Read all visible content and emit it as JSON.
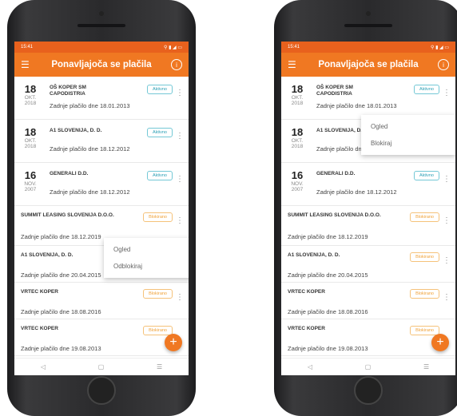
{
  "left": {
    "status_time": "15:41",
    "status_icons": "⚲ ▮ ◢ ▭",
    "appbar": {
      "title": "Ponavljajoča se plačila",
      "menu_icon": "menu-icon",
      "info_icon": "info-icon"
    },
    "rows": [
      {
        "day": "18",
        "month": "OKT.",
        "year": "2018",
        "name": "OŠ KOPER SM CAPODISTRIA",
        "status": "Aktivno",
        "last": "Zadnje plačilo dne 18.01.2013"
      },
      {
        "day": "18",
        "month": "OKT.",
        "year": "2018",
        "name": "A1 SLOVENIJA, D. D.",
        "status": "Aktivno",
        "last": "Zadnje plačilo dne 18.12.2012"
      },
      {
        "day": "16",
        "month": "NOV.",
        "year": "2007",
        "name": "GENERALI D.D.",
        "status": "Aktivno",
        "last": "Zadnje plačilo dne 18.12.2012"
      }
    ],
    "plain_rows": [
      {
        "name": "SUMMIT LEASING SLOVENIJA D.O.O.",
        "status": "Blokirano",
        "last": "Zadnje plačilo dne 18.12.2019"
      },
      {
        "name": "A1 SLOVENIJA, D. D.",
        "status": "",
        "last": "Zadnje plačilo dne 20.04.2015"
      },
      {
        "name": "VRTEC KOPER",
        "status": "Blokirano",
        "last": "Zadnje plačilo dne 18.08.2016"
      },
      {
        "name": "VRTEC KOPER",
        "status": "Blokirano",
        "last": "Zadnje plačilo dne 19.08.2013"
      }
    ],
    "popup": {
      "item1": "Ogled",
      "item2": "Odblokiraj"
    },
    "fab": "+",
    "nav": {
      "back": "◁",
      "home": "▢",
      "recent": "☰"
    }
  },
  "right": {
    "status_time": "15:41",
    "status_icons": "⚲ ▮ ◢ ▭",
    "appbar": {
      "title": "Ponavljajoča se plačila"
    },
    "rows": [
      {
        "day": "18",
        "month": "OKT.",
        "year": "2018",
        "name": "OŠ KOPER SM CAPODISTRIA",
        "status": "Aktivno",
        "last": "Zadnje plačilo dne 18.01.2013"
      },
      {
        "day": "18",
        "month": "OKT.",
        "year": "2018",
        "name": "A1 SLOVENIJA, D. D.",
        "status": "",
        "last": "Zadnje plačilo dne 18.12.2012"
      },
      {
        "day": "16",
        "month": "NOV.",
        "year": "2007",
        "name": "GENERALI D.D.",
        "status": "Aktivno",
        "last": "Zadnje plačilo dne 18.12.2012"
      }
    ],
    "plain_rows": [
      {
        "name": "SUMMIT LEASING SLOVENIJA D.O.O.",
        "status": "Blokirano",
        "last": "Zadnje plačilo dne 18.12.2019"
      },
      {
        "name": "A1 SLOVENIJA, D. D.",
        "status": "Blokirano",
        "last": "Zadnje plačilo dne 20.04.2015"
      },
      {
        "name": "VRTEC KOPER",
        "status": "Blokirano",
        "last": "Zadnje plačilo dne 18.08.2016"
      },
      {
        "name": "VRTEC KOPER",
        "status": "Blokirano",
        "last": "Zadnje plačilo dne 19.08.2013"
      }
    ],
    "popup": {
      "item1": "Ogled",
      "item2": "Blokiraj"
    },
    "fab": "+",
    "nav": {
      "back": "◁",
      "home": "▢",
      "recent": "☰"
    }
  }
}
